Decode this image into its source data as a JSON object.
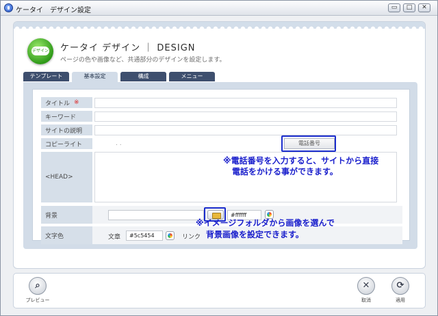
{
  "window": {
    "title": "ケータイ　デザイン設定",
    "minimize_glyph": "▭",
    "maximize_glyph": "□",
    "close_glyph": "✕"
  },
  "header": {
    "logo_text": "デザイン",
    "title": "ケータイ デザイン ｜ DESIGN",
    "subtitle": "ページの色や画像など、共通部分のデザインを設定します。"
  },
  "tabs": [
    {
      "label": "テンプレート",
      "active": false
    },
    {
      "label": "基本設定",
      "active": true
    },
    {
      "label": "構成",
      "active": false
    },
    {
      "label": "メニュー",
      "active": false
    }
  ],
  "form": {
    "title_label": "タイトル",
    "required_mark": "※",
    "keyword_label": "キーワード",
    "description_label": "サイトの説明",
    "copyright_label": "コピーライト",
    "copyright_dots": ". .",
    "phone_button": "電話番号",
    "head_label": "<HEAD>",
    "background_label": "背景",
    "background_color": "#ffffff",
    "text_color_label": "文字色",
    "body_text_label": "文章",
    "body_text_color": "#5c5454",
    "link_label": "リンク"
  },
  "annotations": {
    "phone_line1": "※電話番号を入力すると、サイトから直接",
    "phone_line2": "電話をかける事ができます。",
    "image_line1": "※イメージフォルダから画像を選んで",
    "image_line2": "背景画像を設定できます。"
  },
  "footer": {
    "preview_label": "プレビュー",
    "preview_icon": "search-icon",
    "cancel_label": "取消",
    "cancel_icon": "close-icon",
    "apply_label": "適用",
    "apply_icon": "refresh-icon"
  },
  "colors": {
    "tab_bg": "#3e4f6e",
    "panel_bg": "#d2dce8",
    "annotation": "#1a1fcc",
    "logo_green": "#2f9a19"
  }
}
